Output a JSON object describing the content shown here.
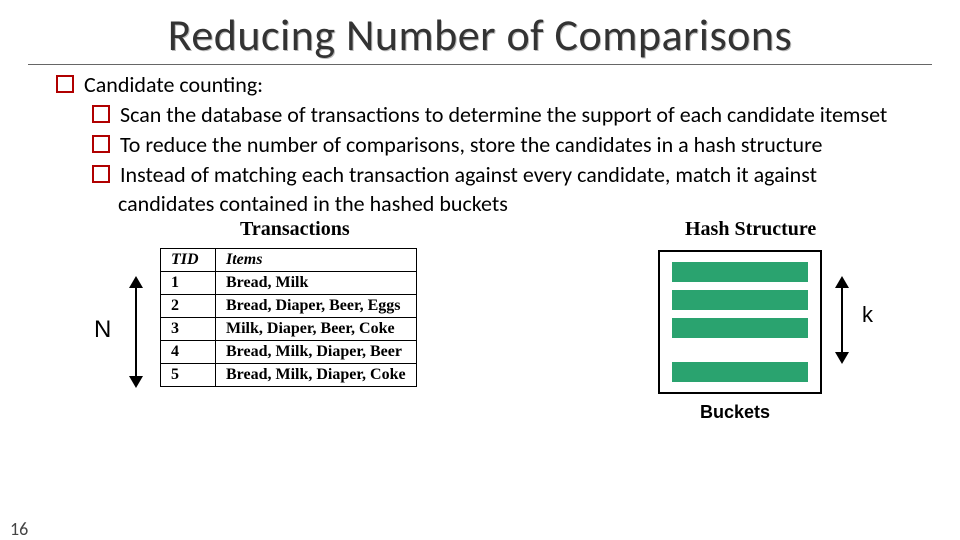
{
  "title": "Reducing Number of Comparisons",
  "bullets": {
    "main": "Candidate counting:",
    "sub1": "Scan the database of transactions to determine the support of each candidate itemset",
    "sub2": "To reduce the number of comparisons, store the candidates in a hash structure",
    "sub3": "Instead of matching each transaction against every candidate, match it against candidates contained in the hashed buckets"
  },
  "figure": {
    "transactions_label": "Transactions",
    "hash_label": "Hash Structure",
    "n_label": "N",
    "k_label": "k",
    "buckets_label": "Buckets",
    "table": {
      "col_tid": "TID",
      "col_items": "Items",
      "rows": [
        {
          "tid": "1",
          "items": "Bread, Milk"
        },
        {
          "tid": "2",
          "items": "Bread, Diaper, Beer, Eggs"
        },
        {
          "tid": "3",
          "items": "Milk, Diaper, Beer, Coke"
        },
        {
          "tid": "4",
          "items": "Bread, Milk, Diaper, Beer"
        },
        {
          "tid": "5",
          "items": "Bread, Milk, Diaper, Coke"
        }
      ]
    }
  },
  "page_number": "16"
}
